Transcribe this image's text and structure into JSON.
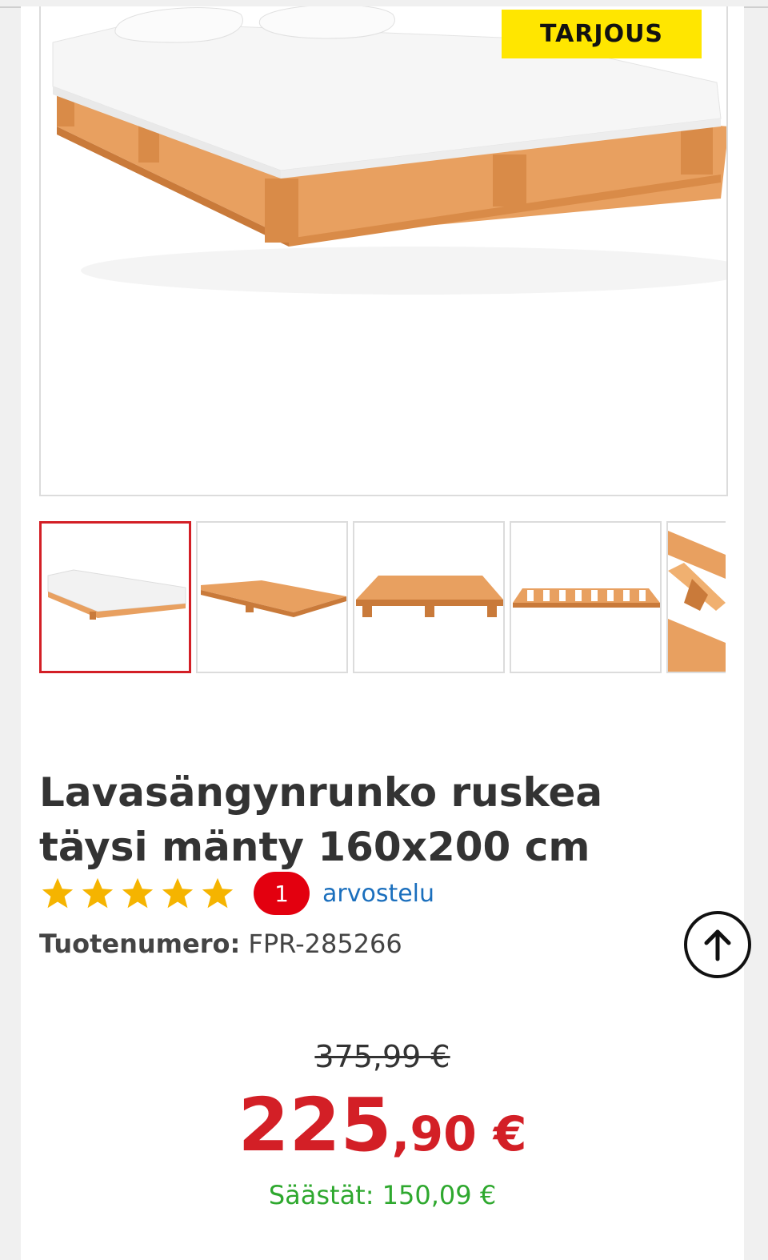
{
  "product": {
    "badge": "TARJOUS",
    "title": "Lavasängynrunko ruskea täysi mänty 160x200 cm",
    "rating_stars": 5,
    "review_count": "1",
    "reviews_label": "arvostelu",
    "sku_label": "Tuotenumero:",
    "sku_value": "FPR-285266",
    "old_price": "375,99 €",
    "price_whole": "225",
    "price_fraction": ",90 €",
    "savings": "Säästät: 150,09 €"
  },
  "gallery": {
    "thumbnails": [
      "bed-with-mattress",
      "pallet-frame-angle",
      "pallet-frame-front",
      "pallet-frame-top",
      "pallet-detail"
    ],
    "selected_index": 0
  },
  "colors": {
    "accent_red": "#d31f26",
    "badge_yellow": "#ffe600",
    "link_blue": "#1b6fbd",
    "savings_green": "#2ea82e",
    "star_gold": "#f5b400",
    "wood": "#e8a060"
  }
}
